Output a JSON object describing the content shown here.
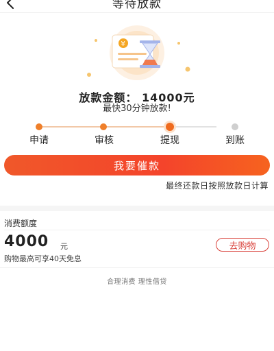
{
  "header": {
    "title": "等待放款"
  },
  "loan": {
    "amount_label": "放款金额：",
    "amount_value": "14000元",
    "eta_text": "最快30分钟放款!"
  },
  "steps": [
    {
      "label": "申请",
      "state": "done"
    },
    {
      "label": "审核",
      "state": "done"
    },
    {
      "label": "提现",
      "state": "current"
    },
    {
      "label": "到账",
      "state": "todo"
    }
  ],
  "actions": {
    "remind_label": "我要催款",
    "repay_note": "最终还款日按照放款日计算"
  },
  "credit": {
    "title": "消费额度",
    "amount": "4000",
    "unit": "元",
    "description": "购物最高可享40天免息",
    "shop_label": "去购物"
  },
  "footer": {
    "slogan": "合理消费 理性借贷"
  },
  "colors": {
    "accent": "#ef6b1e",
    "button_gradient_start": "#f0582a",
    "button_gradient_end": "#f6631f",
    "shop_border": "#d9413a"
  },
  "icons": {
    "back": "back-arrow-icon",
    "illustration": "money-hourglass-icon"
  }
}
